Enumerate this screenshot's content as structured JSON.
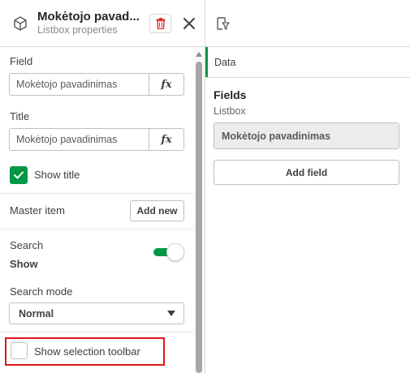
{
  "header": {
    "title": "Mokėtojo pavad...",
    "subtitle": "Listbox properties"
  },
  "properties": {
    "field": {
      "label": "Field",
      "value": "Mokėtojo pavadinimas",
      "fx": "fx"
    },
    "title": {
      "label": "Title",
      "value": "Mokėtojo pavadinimas",
      "fx": "fx"
    },
    "show_title": {
      "label": "Show title",
      "checked": true
    },
    "master_item": {
      "label": "Master item",
      "button": "Add new"
    },
    "search": {
      "label": "Search",
      "value": "Show",
      "enabled": true
    },
    "search_mode": {
      "label": "Search mode",
      "selected": "Normal"
    },
    "show_selection_toolbar": {
      "label": "Show selection toolbar",
      "checked": false
    }
  },
  "right_panel": {
    "tab": "Data",
    "fields_title": "Fields",
    "fields_subtitle": "Listbox",
    "field_value": "Mokėtojo pavadinimas",
    "add_field": "Add field"
  },
  "colors": {
    "accent": "#009845",
    "highlight": "#e0171b",
    "delete": "#d9342b"
  }
}
